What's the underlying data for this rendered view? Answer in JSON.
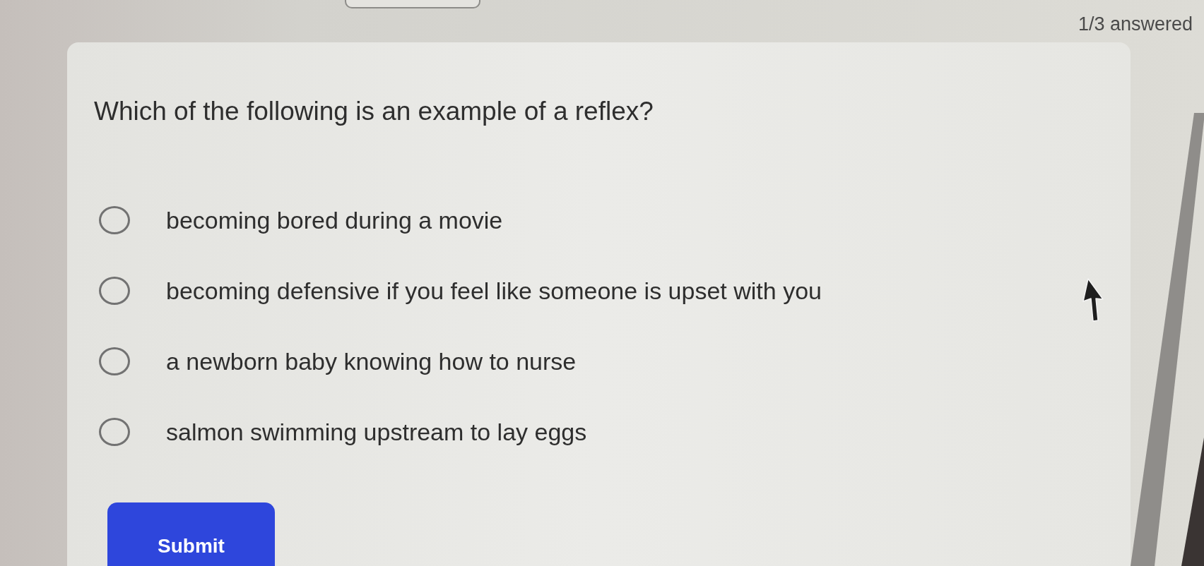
{
  "progress": {
    "text": "1/3 answered"
  },
  "question": {
    "text": "Which of the following is an example of a reflex?",
    "options": [
      {
        "label": "becoming bored during a movie",
        "selected": false
      },
      {
        "label": "becoming defensive if you feel like someone is upset with you",
        "selected": false
      },
      {
        "label": "a newborn baby knowing how to nurse",
        "selected": false
      },
      {
        "label": "salmon swimming upstream to lay eggs",
        "selected": false
      }
    ]
  },
  "submit": {
    "label": "Submit"
  }
}
